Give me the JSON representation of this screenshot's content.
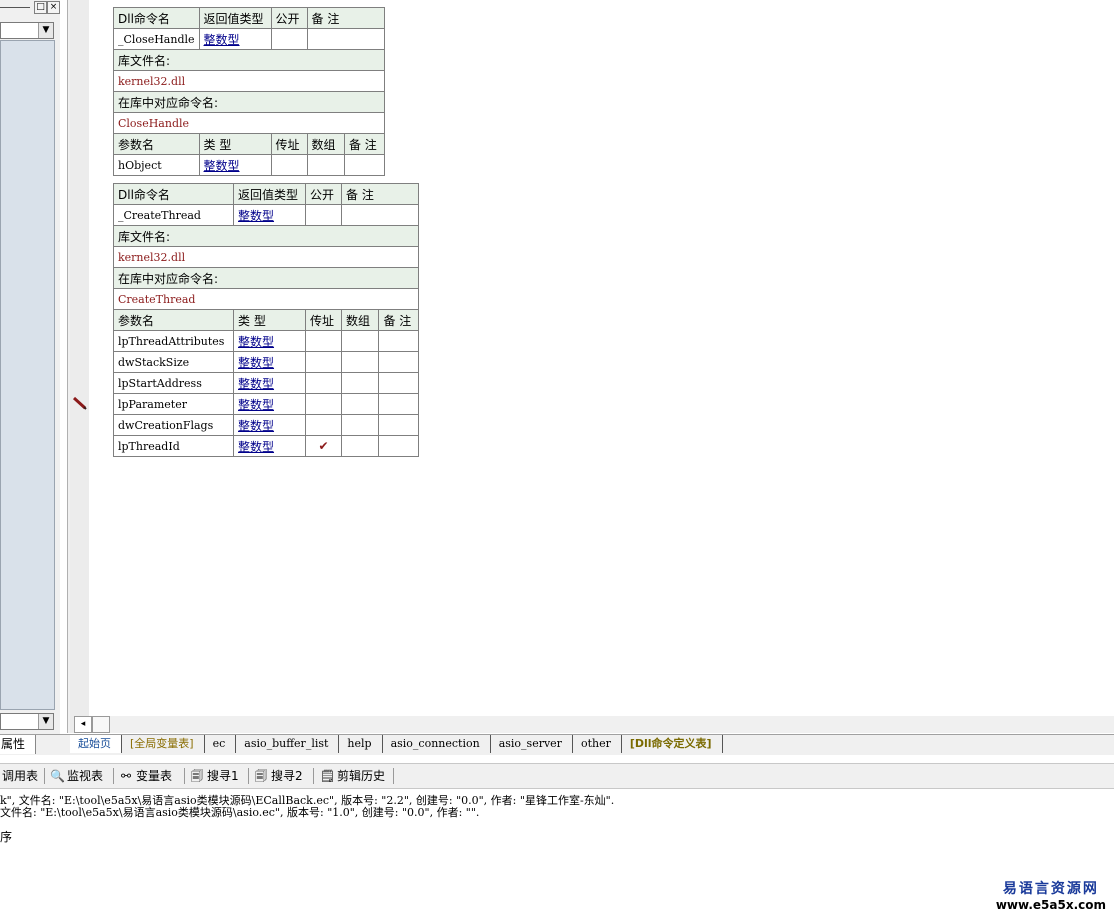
{
  "left_panel": {
    "window_buttons": [
      "□",
      "×"
    ],
    "combo_arrow": "▼"
  },
  "tables": [
    {
      "header": {
        "name": "Dll命令名",
        "return_type": "返回值类型",
        "public": "公开",
        "note": "备 注"
      },
      "command": {
        "name": "_CloseHandle",
        "return_type": "整数型",
        "public": "",
        "note": ""
      },
      "lib_label": "库文件名:",
      "lib_value": "kernel32.dll",
      "entry_label": "在库中对应命令名:",
      "entry_value": "CloseHandle",
      "param_header": {
        "name": "参数名",
        "type": "类 型",
        "byref": "传址",
        "array": "数组",
        "note": "备 注"
      },
      "params": [
        {
          "name": "hObject",
          "type": "整数型",
          "byref": "",
          "array": "",
          "note": ""
        }
      ]
    },
    {
      "header": {
        "name": "Dll命令名",
        "return_type": "返回值类型",
        "public": "公开",
        "note": "备 注"
      },
      "command": {
        "name": "_CreateThread",
        "return_type": "整数型",
        "public": "",
        "note": ""
      },
      "lib_label": "库文件名:",
      "lib_value": "kernel32.dll",
      "entry_label": "在库中对应命令名:",
      "entry_value": "CreateThread",
      "param_header": {
        "name": "参数名",
        "type": "类 型",
        "byref": "传址",
        "array": "数组",
        "note": "备 注"
      },
      "params": [
        {
          "name": "lpThreadAttributes",
          "type": "整数型",
          "byref": "",
          "array": "",
          "note": ""
        },
        {
          "name": "dwStackSize",
          "type": "整数型",
          "byref": "",
          "array": "",
          "note": ""
        },
        {
          "name": "lpStartAddress",
          "type": "整数型",
          "byref": "",
          "array": "",
          "note": ""
        },
        {
          "name": "lpParameter",
          "type": "整数型",
          "byref": "",
          "array": "",
          "note": ""
        },
        {
          "name": "dwCreationFlags",
          "type": "整数型",
          "byref": "",
          "array": "",
          "note": ""
        },
        {
          "name": "lpThreadId",
          "type": "整数型",
          "byref": "✔",
          "array": "",
          "note": ""
        }
      ]
    }
  ],
  "tab_row": {
    "property_tab": "属性",
    "tabs": [
      "起始页",
      "[全局变量表]",
      "ec",
      "asio_buffer_list",
      "help",
      "asio_connection",
      "asio_server",
      "other",
      "[Dll命令定义表]"
    ]
  },
  "toolbar": {
    "items": [
      {
        "icon": "",
        "label": "调用表"
      },
      {
        "icon": "🔍",
        "label": "监视表"
      },
      {
        "icon": "⚯",
        "label": "变量表"
      },
      {
        "icon": "🗐",
        "label": "搜寻1"
      },
      {
        "icon": "🗐",
        "label": "搜寻2"
      },
      {
        "icon": "🗒",
        "label": "剪辑历史"
      }
    ]
  },
  "output": {
    "lines": [
      "k\", 文件名: \"E:\\tool\\e5a5x\\易语言asio类模块源码\\ECallBack.ec\", 版本号: \"2.2\", 创建号: \"0.0\", 作者: \"星锋工作室-东灿\".",
      "文件名: \"E:\\tool\\e5a5x\\易语言asio类模块源码\\asio.ec\", 版本号: \"1.0\", 创建号: \"0.0\", 作者: \"\".",
      "",
      "序"
    ]
  },
  "watermark": {
    "cn": "易语言资源网",
    "url": "www.e5a5x.com"
  }
}
